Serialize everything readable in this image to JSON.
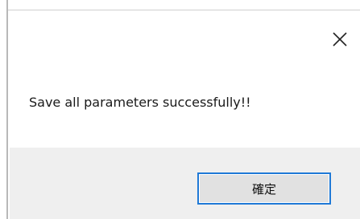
{
  "dialog": {
    "message": "Save all parameters successfully!!",
    "ok_label": "確定",
    "close_icon": "close-icon"
  },
  "colors": {
    "footer_background": "#efefef",
    "button_border": "#1f79d6",
    "button_face": "#e1e1e1"
  }
}
